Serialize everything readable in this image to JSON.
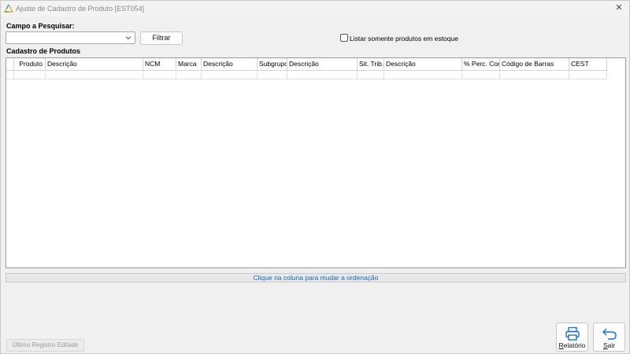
{
  "window": {
    "title": "Ajuste de Cadastro de Produto [EST054]",
    "close_glyph": "✕"
  },
  "search": {
    "label": "Campo a Pesquisar:",
    "selected_value": "",
    "filter_button": "Filtrar",
    "stock_checkbox_label": "Listar somente produtos em estoque",
    "stock_checkbox_checked": false
  },
  "grid": {
    "label": "Cadastro de Produtos",
    "columns": [
      "Produto",
      "Descrição",
      "NCM",
      "Marca",
      "Descrição",
      "Subgrupo",
      "Descrição",
      "Sit. Trib.",
      "Descrição",
      "% Perc. Com",
      "Código de Barras",
      "CEST"
    ],
    "rows": []
  },
  "status": {
    "sort_hint": "Clique na coluna para mudar a ordenação"
  },
  "footer": {
    "last_record_button": "Último Registro Editado",
    "report_button_accel": "R",
    "report_button_rest": "elatório",
    "exit_button_accel": "S",
    "exit_button_rest": "air"
  },
  "colors": {
    "accent": "#1565c0",
    "icon_blue": "#1a6fd0"
  },
  "icons": {
    "app": "app-logo-icon",
    "close": "close-icon",
    "dropdown": "chevron-down-icon",
    "report": "printer-icon",
    "exit": "return-arrow-icon"
  }
}
